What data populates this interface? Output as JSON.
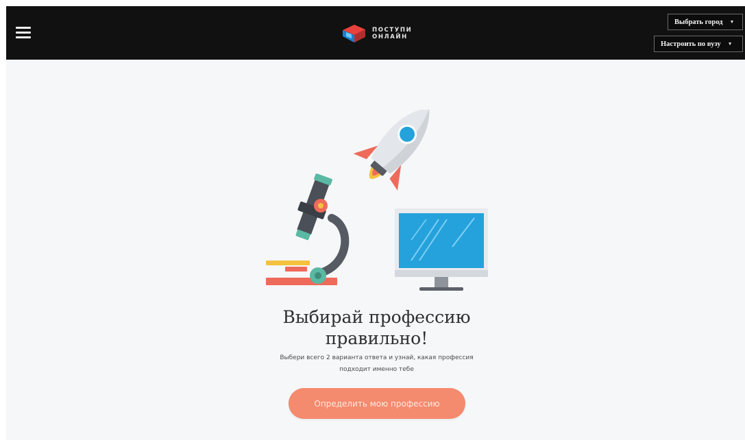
{
  "header": {
    "logo_text_line1": "поступи",
    "logo_text_line2": "онлайн",
    "city_button": "Выбрать город",
    "vuz_button": "Настроить по вузу",
    "caret": "▼"
  },
  "hero": {
    "title_line1": "Выбирай профессию",
    "title_line2": "правильно!",
    "subtitle_line1": "Выбери всего 2 варианта ответа и узнай, какая профессия",
    "subtitle_line2": "подходит именно тебе",
    "cta_label": "Определить мою профессию"
  },
  "colors": {
    "header_bg": "#111111",
    "content_bg": "#f6f7f9",
    "accent": "#f48a6e"
  },
  "icons": [
    "menu-icon",
    "logo-icon",
    "rocket-illustration",
    "microscope-illustration",
    "monitor-illustration"
  ]
}
